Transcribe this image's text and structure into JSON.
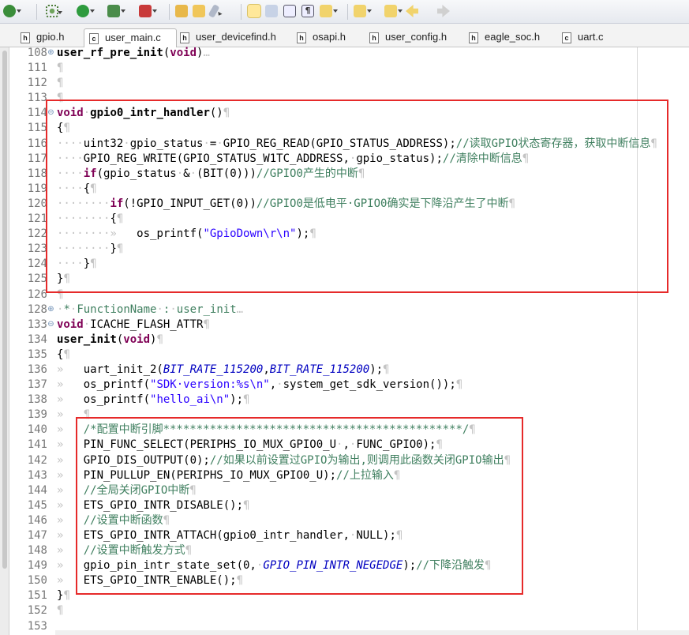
{
  "toolbar": {
    "icons": [
      "debug-icon",
      "settings-gear-icon",
      "run-icon",
      "run-config-icon",
      "stop-icon",
      "open-folder-icon",
      "open-file-icon",
      "build-icon",
      "highlight-icon",
      "mark-occurrences-icon",
      "block-select-icon",
      "show-whitespace-icon",
      "next-annotation-icon",
      "prev-annotation-icon",
      "last-edit-icon",
      "back-icon",
      "forward-icon"
    ]
  },
  "tabs": [
    {
      "label": "gpio.h",
      "type": "h",
      "active": false
    },
    {
      "label": "user_main.c",
      "type": "c",
      "active": true
    },
    {
      "label": "user_devicefind.h",
      "type": "h",
      "active": false
    },
    {
      "label": "osapi.h",
      "type": "h",
      "active": false
    },
    {
      "label": "user_config.h",
      "type": "h",
      "active": false
    },
    {
      "label": "eagle_soc.h",
      "type": "h",
      "active": false
    },
    {
      "label": "uart.c",
      "type": "c",
      "active": false
    }
  ],
  "colors": {
    "highlight_box": "#e62a2a",
    "keyword": "#7f0055",
    "comment": "#3f7f5f",
    "string": "#2a00ff",
    "constant": "#0000c0"
  },
  "code_lines": [
    {
      "num": "108",
      "fold": "+",
      "parts": [
        [
          "fn",
          "user_rf_pre_init"
        ],
        [
          "",
          "("
        ],
        [
          "kw",
          "void"
        ],
        [
          "",
          ")"
        ],
        [
          "ws",
          "…"
        ]
      ]
    },
    {
      "num": "111",
      "parts": [
        [
          "ws",
          "¶"
        ]
      ]
    },
    {
      "num": "112",
      "parts": [
        [
          "ws",
          "¶"
        ]
      ]
    },
    {
      "num": "113",
      "parts": [
        [
          "ws",
          "¶"
        ]
      ]
    },
    {
      "num": "114",
      "fold": "-",
      "parts": [
        [
          "kw",
          "void"
        ],
        [
          "ws",
          "·"
        ],
        [
          "fn",
          "gpio0_intr_handler"
        ],
        [
          "",
          "()"
        ],
        [
          "ws",
          "¶"
        ]
      ]
    },
    {
      "num": "115",
      "parts": [
        [
          "",
          "{"
        ],
        [
          "ws",
          "¶"
        ]
      ]
    },
    {
      "num": "116",
      "parts": [
        [
          "ws",
          "····"
        ],
        [
          "",
          "uint32"
        ],
        [
          "ws",
          "·"
        ],
        [
          "",
          "gpio_status"
        ],
        [
          "ws",
          "·"
        ],
        [
          "",
          "="
        ],
        [
          "ws",
          "·"
        ],
        [
          "",
          "GPIO_REG_READ(GPIO_STATUS_ADDRESS);"
        ],
        [
          "cm",
          "//读取GPIO状态寄存器，获取中断信息"
        ],
        [
          "ws",
          "¶"
        ]
      ]
    },
    {
      "num": "117",
      "parts": [
        [
          "ws",
          "····"
        ],
        [
          "",
          "GPIO_REG_WRITE(GPIO_STATUS_W1TC_ADDRESS,"
        ],
        [
          "ws",
          "·"
        ],
        [
          "",
          "gpio_status);"
        ],
        [
          "cm",
          "//清除中断信息"
        ],
        [
          "ws",
          "¶"
        ]
      ]
    },
    {
      "num": "118",
      "parts": [
        [
          "ws",
          "····"
        ],
        [
          "kw",
          "if"
        ],
        [
          "",
          "(gpio_status"
        ],
        [
          "ws",
          "·"
        ],
        [
          "",
          "&"
        ],
        [
          "ws",
          "·"
        ],
        [
          "",
          "(BIT(0)))"
        ],
        [
          "cm",
          "//GPIO0产生的中断"
        ],
        [
          "ws",
          "¶"
        ]
      ]
    },
    {
      "num": "119",
      "parts": [
        [
          "ws",
          "····"
        ],
        [
          "",
          "{"
        ],
        [
          "ws",
          "¶"
        ]
      ]
    },
    {
      "num": "120",
      "parts": [
        [
          "ws",
          "········"
        ],
        [
          "kw",
          "if"
        ],
        [
          "",
          "(!GPIO_INPUT_GET(0))"
        ],
        [
          "cm",
          "//GPIO0是低电平·GPIO0确实是下降沿产生了中断"
        ],
        [
          "ws",
          "¶"
        ]
      ]
    },
    {
      "num": "121",
      "parts": [
        [
          "ws",
          "········"
        ],
        [
          "",
          "{"
        ],
        [
          "ws",
          "¶"
        ]
      ]
    },
    {
      "num": "122",
      "parts": [
        [
          "ws",
          "········»   "
        ],
        [
          "",
          "os_printf("
        ],
        [
          "str",
          "\"GpioDown\\r\\n\""
        ],
        [
          "",
          ");"
        ],
        [
          "ws",
          "¶"
        ]
      ]
    },
    {
      "num": "123",
      "parts": [
        [
          "ws",
          "········"
        ],
        [
          "",
          "}"
        ],
        [
          "ws",
          "¶"
        ]
      ]
    },
    {
      "num": "124",
      "parts": [
        [
          "ws",
          "····"
        ],
        [
          "",
          "}"
        ],
        [
          "ws",
          "¶"
        ]
      ]
    },
    {
      "num": "125",
      "parts": [
        [
          "",
          "}"
        ],
        [
          "ws",
          "¶"
        ]
      ]
    },
    {
      "num": "126",
      "parts": [
        [
          "ws",
          "¶"
        ]
      ]
    },
    {
      "num": "128",
      "fold": "+",
      "parts": [
        [
          "ws",
          "·"
        ],
        [
          "cm",
          "*"
        ],
        [
          "ws",
          "·"
        ],
        [
          "cm",
          "FunctionName"
        ],
        [
          "ws",
          "·"
        ],
        [
          "cm",
          ":"
        ],
        [
          "ws",
          "·"
        ],
        [
          "cm",
          "user_init"
        ],
        [
          "ws",
          "…"
        ]
      ]
    },
    {
      "num": "133",
      "fold": "-",
      "parts": [
        [
          "kw",
          "void"
        ],
        [
          "ws",
          "·"
        ],
        [
          "",
          "ICACHE_FLASH_ATTR"
        ],
        [
          "ws",
          "¶"
        ]
      ]
    },
    {
      "num": "134",
      "parts": [
        [
          "fn",
          "user_init"
        ],
        [
          "",
          "("
        ],
        [
          "kw",
          "void"
        ],
        [
          "",
          ")"
        ],
        [
          "ws",
          "¶"
        ]
      ]
    },
    {
      "num": "135",
      "parts": [
        [
          "",
          "{"
        ],
        [
          "ws",
          "¶"
        ]
      ]
    },
    {
      "num": "136",
      "parts": [
        [
          "ws",
          "»   "
        ],
        [
          "",
          "uart_init_2("
        ],
        [
          "const",
          "BIT_RATE_115200"
        ],
        [
          "",
          ","
        ],
        [
          "const",
          "BIT_RATE_115200"
        ],
        [
          "",
          ");"
        ],
        [
          "ws",
          "¶"
        ]
      ]
    },
    {
      "num": "137",
      "parts": [
        [
          "ws",
          "»   "
        ],
        [
          "",
          "os_printf("
        ],
        [
          "str",
          "\"SDK·version:%s\\n\""
        ],
        [
          "",
          ","
        ],
        [
          "ws",
          "·"
        ],
        [
          "",
          "system_get_sdk_version());"
        ],
        [
          "ws",
          "¶"
        ]
      ]
    },
    {
      "num": "138",
      "parts": [
        [
          "ws",
          "»   "
        ],
        [
          "",
          "os_printf("
        ],
        [
          "str",
          "\"hello_ai\\n\""
        ],
        [
          "",
          ");"
        ],
        [
          "ws",
          "¶"
        ]
      ]
    },
    {
      "num": "139",
      "parts": [
        [
          "ws",
          "»   ¶"
        ]
      ]
    },
    {
      "num": "140",
      "parts": [
        [
          "ws",
          "»   "
        ],
        [
          "cm",
          "/*配置中断引脚*********************************************/"
        ],
        [
          "ws",
          "¶"
        ]
      ]
    },
    {
      "num": "141",
      "parts": [
        [
          "ws",
          "»   "
        ],
        [
          "",
          "PIN_FUNC_SELECT(PERIPHS_IO_MUX_GPIO0_U"
        ],
        [
          "ws",
          "·"
        ],
        [
          "",
          ","
        ],
        [
          "ws",
          "·"
        ],
        [
          "",
          "FUNC_GPIO0);"
        ],
        [
          "ws",
          "¶"
        ]
      ]
    },
    {
      "num": "142",
      "parts": [
        [
          "ws",
          "»   "
        ],
        [
          "",
          "GPIO_DIS_OUTPUT(0);"
        ],
        [
          "cm",
          "//如果以前设置过GPIO为输出,则调用此函数关闭GPIO输出"
        ],
        [
          "ws",
          "¶"
        ]
      ]
    },
    {
      "num": "143",
      "parts": [
        [
          "ws",
          "»   "
        ],
        [
          "",
          "PIN_PULLUP_EN(PERIPHS_IO_MUX_GPIO0_U);"
        ],
        [
          "cm",
          "//上拉输入"
        ],
        [
          "ws",
          "¶"
        ]
      ]
    },
    {
      "num": "144",
      "parts": [
        [
          "ws",
          "»   "
        ],
        [
          "cm",
          "//全局关闭GPIO中断"
        ],
        [
          "ws",
          "¶"
        ]
      ]
    },
    {
      "num": "145",
      "parts": [
        [
          "ws",
          "»   "
        ],
        [
          "",
          "ETS_GPIO_INTR_DISABLE();"
        ],
        [
          "ws",
          "¶"
        ]
      ]
    },
    {
      "num": "146",
      "parts": [
        [
          "ws",
          "»   "
        ],
        [
          "cm",
          "//设置中断函数"
        ],
        [
          "ws",
          "¶"
        ]
      ]
    },
    {
      "num": "147",
      "parts": [
        [
          "ws",
          "»   "
        ],
        [
          "",
          "ETS_GPIO_INTR_ATTACH(gpio0_intr_handler,"
        ],
        [
          "ws",
          "·"
        ],
        [
          "",
          "NULL);"
        ],
        [
          "ws",
          "¶"
        ]
      ]
    },
    {
      "num": "148",
      "parts": [
        [
          "ws",
          "»   "
        ],
        [
          "cm",
          "//设置中断触发方式"
        ],
        [
          "ws",
          "¶"
        ]
      ]
    },
    {
      "num": "149",
      "parts": [
        [
          "ws",
          "»   "
        ],
        [
          "",
          "gpio_pin_intr_state_set(0,"
        ],
        [
          "ws",
          "·"
        ],
        [
          "const",
          "GPIO_PIN_INTR_NEGEDGE"
        ],
        [
          "",
          ");"
        ],
        [
          "cm",
          "//下降沿触发"
        ],
        [
          "ws",
          "¶"
        ]
      ]
    },
    {
      "num": "150",
      "parts": [
        [
          "ws",
          "»   "
        ],
        [
          "",
          "ETS_GPIO_INTR_ENABLE();"
        ],
        [
          "ws",
          "¶"
        ]
      ]
    },
    {
      "num": "151",
      "parts": [
        [
          "",
          "}"
        ],
        [
          "ws",
          "¶"
        ]
      ]
    },
    {
      "num": "152",
      "parts": [
        [
          "ws",
          "¶"
        ]
      ]
    },
    {
      "num": "153",
      "parts": []
    }
  ]
}
